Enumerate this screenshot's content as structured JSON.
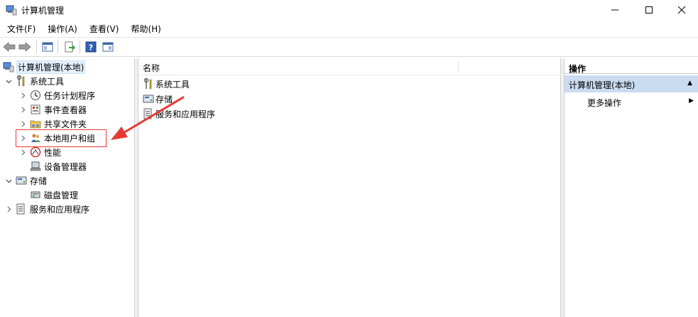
{
  "window": {
    "title": "计算机管理",
    "icon": "computer-management-icon"
  },
  "menu": [
    "文件(F)",
    "操作(A)",
    "查看(V)",
    "帮助(H)"
  ],
  "tree": {
    "root": "计算机管理(本地)",
    "system_tools": "系统工具",
    "task_scheduler": "任务计划程序",
    "event_viewer": "事件查看器",
    "shared_folders": "共享文件夹",
    "local_users": "本地用户和组",
    "performance": "性能",
    "device_manager": "设备管理器",
    "storage": "存储",
    "disk_management": "磁盘管理",
    "services_apps": "服务和应用程序"
  },
  "center": {
    "column_name": "名称",
    "items": [
      "系统工具",
      "存储",
      "服务和应用程序"
    ]
  },
  "actions": {
    "header": "操作",
    "section": "计算机管理(本地)",
    "more": "更多操作"
  },
  "colors": {
    "annotation": "#e53935",
    "selection": "#e5f0fb",
    "actions_section_bg": "#c9dcf0"
  }
}
